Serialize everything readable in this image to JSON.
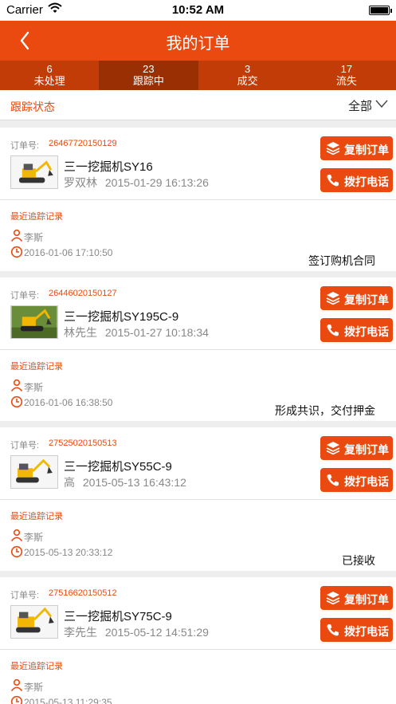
{
  "status_bar": {
    "carrier": "Carrier",
    "time": "10:52 AM"
  },
  "header": {
    "title": "我的订单"
  },
  "tabs": [
    {
      "count": "6",
      "label": "未处理"
    },
    {
      "count": "23",
      "label": "跟踪中"
    },
    {
      "count": "3",
      "label": "成交"
    },
    {
      "count": "17",
      "label": "流失"
    }
  ],
  "filter": {
    "label": "跟踪状态",
    "value": "全部"
  },
  "labels": {
    "order_no": "订单号:",
    "recent_record": "最近追踪记录",
    "copy_order": "复制订单",
    "call_phone": "拨打电话"
  },
  "orders": [
    {
      "order_no": "26467720150129",
      "product": "三一挖掘机SY16",
      "customer": "罗双林",
      "date": "2015-01-29 16:13:26",
      "tracker": "李斯",
      "track_time": "2016-01-06 17:10:50",
      "record": "签订购机合同"
    },
    {
      "order_no": "26446020150127",
      "product": "三一挖掘机SY195C-9",
      "customer": "林先生",
      "date": "2015-01-27 10:18:34",
      "tracker": "李斯",
      "track_time": "2016-01-06 16:38:50",
      "record": "形成共识，交付押金"
    },
    {
      "order_no": "27525020150513",
      "product": "三一挖掘机SY55C-9",
      "customer": "高",
      "date": "2015-05-13 16:43:12",
      "tracker": "李斯",
      "track_time": "2015-05-13 20:33:12",
      "record": "已接收"
    },
    {
      "order_no": "27516620150512",
      "product": "三一挖掘机SY75C-9",
      "customer": "李先生",
      "date": "2015-05-12 14:51:29",
      "tracker": "李斯",
      "track_time": "2015-05-13 11:29:35",
      "record": ""
    }
  ],
  "colors": {
    "brand": "#ea4a0f",
    "tab_bar": "#c13c06",
    "tab_active": "#992f02"
  }
}
